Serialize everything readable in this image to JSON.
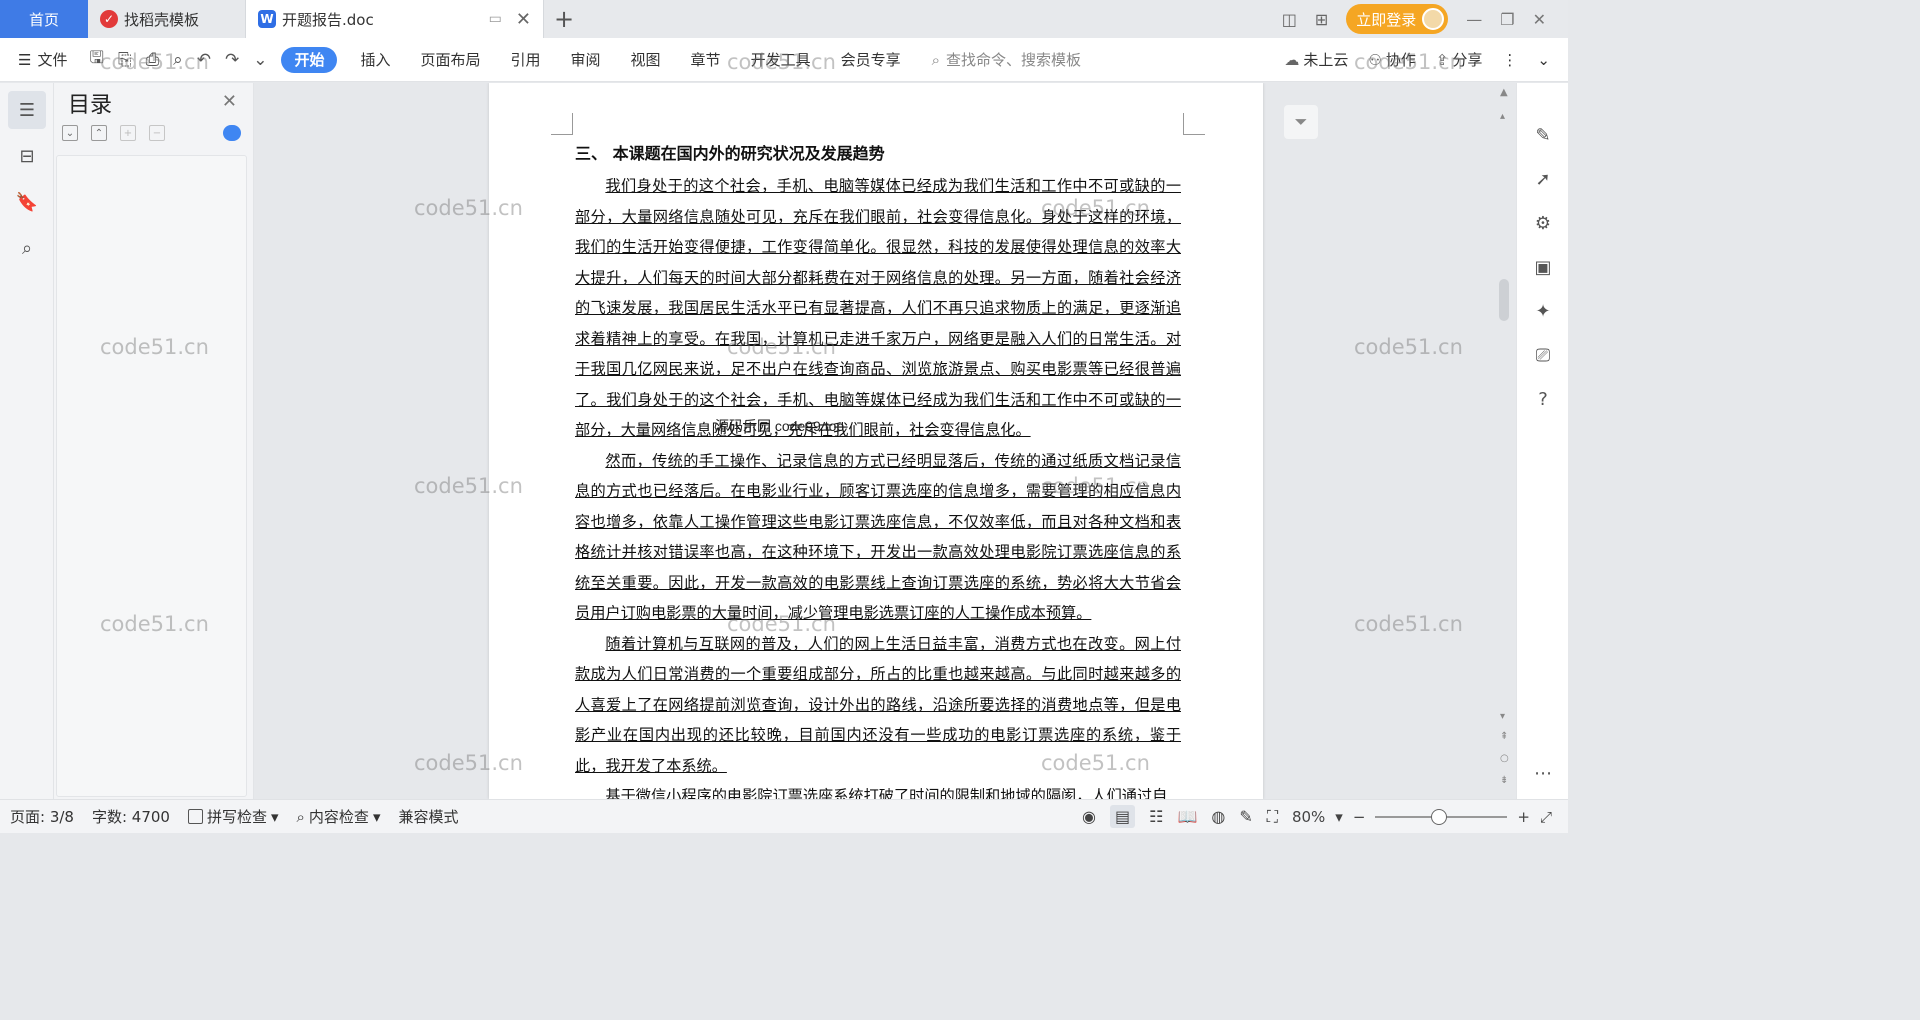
{
  "tabbar": {
    "home_label": "首页",
    "tab1_label": "找稻壳模板",
    "active_tab_label": "开题报告.doc",
    "active_tab_icon": "W",
    "login_label": "立即登录"
  },
  "toolbar": {
    "file_label": "文件",
    "tabs": [
      "开始",
      "插入",
      "页面布局",
      "引用",
      "审阅",
      "视图",
      "章节",
      "开发工具",
      "会员专享"
    ],
    "search_placeholder": "查找命令、搜索模板",
    "cloud_label": "未上云",
    "collab_label": "协作",
    "share_label": "分享"
  },
  "toc": {
    "title": "目录"
  },
  "document": {
    "heading": "三、 本课题在国内外的研究状况及发展趋势",
    "paragraphs": [
      "我们身处于的这个社会，手机、电脑等媒体已经成为我们生活和工作中不可或缺的一部分，大量网络信息随处可见，充斥在我们眼前，社会变得信息化。身处于这样的环境，我们的生活开始变得便捷，工作变得简单化。很显然，科技的发展使得处理信息的效率大大提升，人们每天的时间大部分都耗费在对于网络信息的处理。另一方面，随着社会经济的飞速发展，我国居民生活水平已有显著提高，人们不再只追求物质上的满足，更逐渐追求着精神上的享受。在我国，计算机已走进千家万户，网络更是融入人们的日常生活。对于我国几亿网民来说，足不出户在线查询商品、浏览旅游景点、购买电影票等已经很普遍了。我们身处于的这个社会，手机、电脑等媒体已经成为我们生活和工作中不可或缺的一部分，大量网络信息随处可见，充斥在我们眼前，社会变得信息化。",
      "然而，传统的手工操作、记录信息的方式已经明显落后，传统的通过纸质文档记录信息的方式也已经落后。在电影业行业，顾客订票选座的信息增多，需要管理的相应信息内容也增多，依靠人工操作管理这些电影订票选座信息，不仅效率低，而且对各种文档和表格统计并核对错误率也高，在这种环境下，开发出一款高效处理电影院订票选座信息的系统至关重要。因此，开发一款高效的电影票线上查询订票选座的系统，势必将大大节省会员用户订购电影票的大量时间，减少管理电影选票订座的人工操作成本预算。",
      "随着计算机与互联网的普及，人们的网上生活日益丰富，消费方式也在改变。网上付款成为人们日常消费的一个重要组成部分，所占的比重也越来越高。与此同时越来越多的人喜爱上了在网络提前浏览查询，设计外出的路线，沿途所要选择的消费地点等，但是电影产业在国内出现的还比较晚，目前国内还没有一些成功的电影订票选座的系统，鉴于此，我开发了本系统。",
      "基于微信小程序的电影院订票选座系统打破了时间的限制和地域的隔阂，人们通过自"
    ],
    "overlay_text": "源码乐园 code99.top"
  },
  "watermark": "code51.cn",
  "status": {
    "page": "页面: 3/8",
    "words": "字数: 4700",
    "spell": "拼写检查",
    "content_check": "内容检查",
    "compat": "兼容模式",
    "zoom": "80%",
    "zoom_level": 0.44
  }
}
